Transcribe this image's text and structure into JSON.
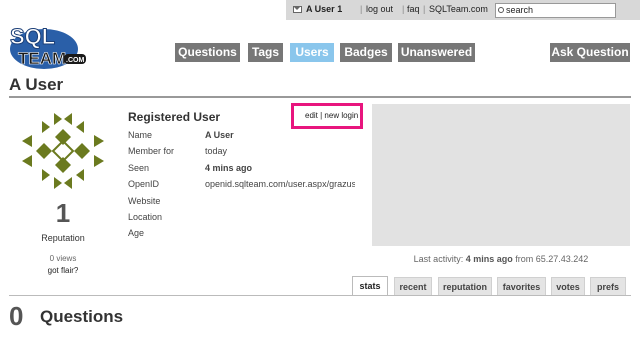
{
  "topbar": {
    "username": "A User",
    "rep": "1",
    "logout": "log out",
    "faq": "faq",
    "site": "SQLTeam.com",
    "search_placeholder": "search"
  },
  "logo": {
    "text_top": "SQL",
    "text_bottom": "TEAM",
    "suffix": ".COM"
  },
  "nav": {
    "items": [
      {
        "label": "Questions",
        "active": false
      },
      {
        "label": "Tags",
        "active": false
      },
      {
        "label": "Users",
        "active": true
      },
      {
        "label": "Badges",
        "active": false
      },
      {
        "label": "Unanswered",
        "active": false
      }
    ],
    "ask": "Ask Question"
  },
  "page": {
    "title": "A User"
  },
  "profile": {
    "reputation": "1",
    "reputation_label": "Reputation",
    "views": "0 views",
    "got_flair": "got flair?",
    "user_type": "Registered User",
    "edit_links": "edit | new login",
    "fields": [
      {
        "label": "Name",
        "value": "A User",
        "bold": true
      },
      {
        "label": "Member for",
        "value": "today",
        "bold": false
      },
      {
        "label": "Seen",
        "value": "4 mins ago",
        "bold": true
      },
      {
        "label": "OpenID",
        "value": "openid.sqlteam.com/user.aspx/grazuser",
        "bold": false
      },
      {
        "label": "Website",
        "value": "",
        "bold": false
      },
      {
        "label": "Location",
        "value": "",
        "bold": false
      },
      {
        "label": "Age",
        "value": "",
        "bold": false
      }
    ],
    "last_activity_prefix": "Last activity:",
    "last_activity_time": "4 mins ago",
    "last_activity_suffix": "from 65.27.43.242"
  },
  "tabs": [
    "stats",
    "recent",
    "reputation",
    "favorites",
    "votes",
    "prefs"
  ],
  "questions": {
    "count": "0",
    "label": "Questions"
  },
  "colors": {
    "nav_bg": "#777777",
    "nav_active": "#8ac6ec",
    "highlight": "#e8157e",
    "identicon": "#6b7a1f",
    "logo_blue": "#2a5fa8"
  }
}
